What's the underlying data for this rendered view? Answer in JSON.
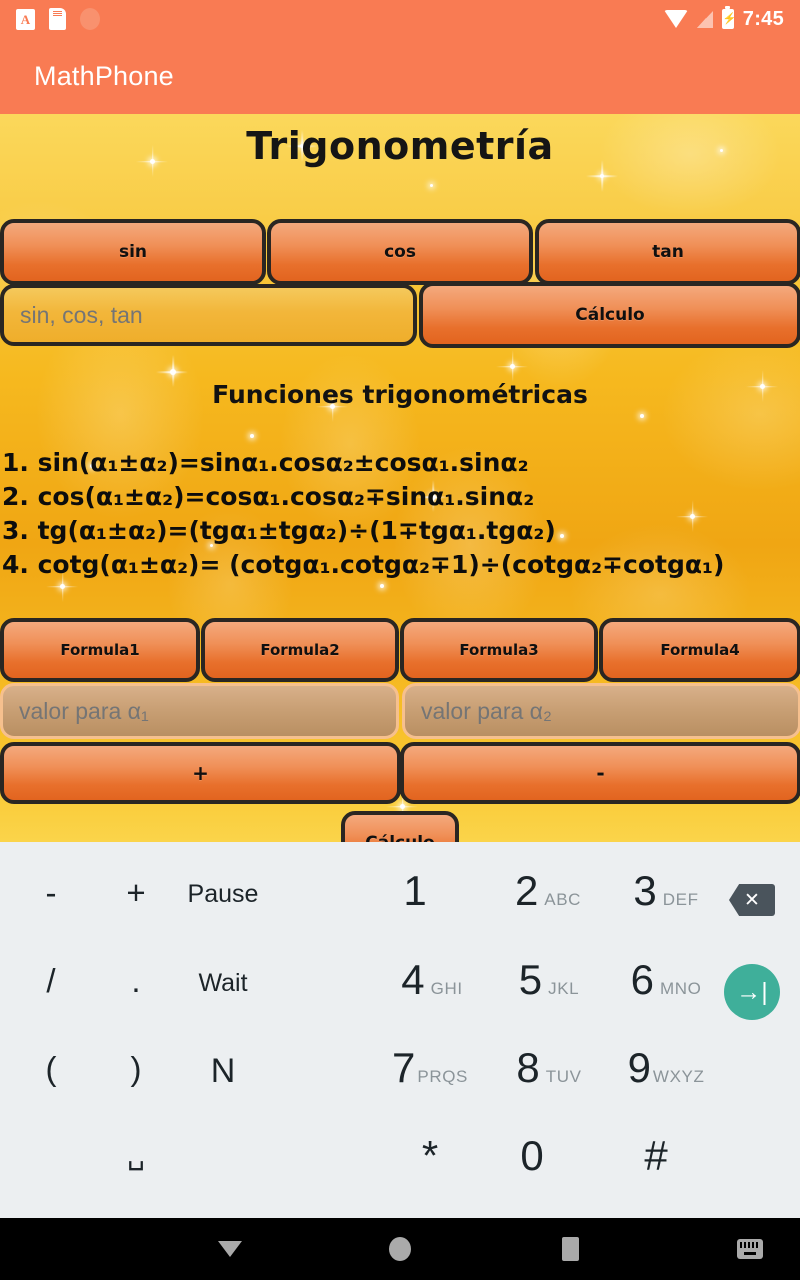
{
  "status_bar": {
    "time": "7:45",
    "icons_left": [
      "font-size-icon",
      "sim-card-icon",
      "circle-indicator-icon"
    ],
    "icons_right": [
      "wifi-icon",
      "cell-signal-icon",
      "battery-charging-icon"
    ],
    "background_color": "#F97B53"
  },
  "app_bar": {
    "title": "MathPhone",
    "background_color": "#F97B53",
    "text_color": "#FFFFFF"
  },
  "page": {
    "title": "Trigonometría",
    "section_title": "Funciones trigonométricas",
    "background_colors": [
      "#FBD85B",
      "#F0A613",
      "#FBD44A"
    ],
    "button_gradient": [
      "#F4A97D",
      "#E2641F"
    ],
    "button_border_color": "#2A2622"
  },
  "function_buttons": [
    {
      "label": "sin",
      "name": "sin-button"
    },
    {
      "label": "cos",
      "name": "cos-button"
    },
    {
      "label": "tan",
      "name": "tan-button"
    }
  ],
  "function_input": {
    "value": "",
    "placeholder": "sin, cos, tan"
  },
  "calc_button_top": {
    "label": "Cálculo"
  },
  "formulas": [
    {
      "num": "1.",
      "parts": [
        "sin(α",
        "1",
        "±α",
        "2",
        ")=sinα",
        "1",
        ".cosα",
        "2",
        "±cosα",
        "1",
        ".sinα",
        "2"
      ]
    },
    {
      "num": "2.",
      "parts": [
        "cos(α",
        "1",
        "±α",
        "2",
        ")=cosα",
        "1",
        ".cosα",
        "2",
        "∓sinα",
        "1",
        ".sinα",
        "2"
      ]
    },
    {
      "num": "3.",
      "parts": [
        "tg(α",
        "1",
        "±α",
        "2",
        ")=(tgα",
        "1",
        "±tgα",
        "2",
        ")÷(1∓tgα",
        "1",
        ".tgα",
        "2",
        ")"
      ]
    },
    {
      "num": "4.",
      "parts": [
        "cotg(α",
        "1",
        "±α",
        "2",
        ")= (cotgα",
        "1",
        ".cotgα",
        "2",
        "∓1)÷(cotgα",
        "2",
        "∓cotgα",
        "1",
        ")"
      ]
    }
  ],
  "formula_lines": {
    "l1": "1. sin(α₁±α₂)=sinα₁.cosα₂±cosα₁.sinα₂",
    "l2": "2. cos(α₁±α₂)=cosα₁.cosα₂∓sinα₁.sinα₂",
    "l3": "3. tg(α₁±α₂)=(tgα₁±tgα₂)÷(1∓tgα₁.tgα₂)",
    "l4": "4. cotg(α₁±α₂)= (cotgα₁.cotgα₂∓1)÷(cotgα₂∓cotgα₁)"
  },
  "formula_buttons": [
    {
      "label": "Formula1",
      "name": "formula1-button"
    },
    {
      "label": "Formula2",
      "name": "formula2-button"
    },
    {
      "label": "Formula3",
      "name": "formula3-button"
    },
    {
      "label": "Formula4",
      "name": "formula4-button"
    }
  ],
  "alpha_inputs": [
    {
      "value": "",
      "placeholder": "valor para α₁"
    },
    {
      "value": "",
      "placeholder": "valor para α₂"
    }
  ],
  "sign_buttons": [
    {
      "label": "+",
      "name": "plus-button"
    },
    {
      "label": "-",
      "name": "minus-button"
    }
  ],
  "calc_button_bottom": {
    "label": "Cálculo"
  },
  "keyboard": {
    "background_color": "#ECEFF1",
    "enter_color": "#3FAF9A",
    "backspace_color": "#4A545C",
    "left_pad": [
      [
        {
          "label": "-",
          "type": "sym"
        },
        {
          "label": "+",
          "type": "sym"
        },
        {
          "label": "Pause",
          "type": "word"
        }
      ],
      [
        {
          "label": "/",
          "type": "sym"
        },
        {
          "label": ".",
          "type": "sym"
        },
        {
          "label": "Wait",
          "type": "word"
        }
      ],
      [
        {
          "label": "(",
          "type": "sym"
        },
        {
          "label": ")",
          "type": "sym"
        },
        {
          "label": "N",
          "type": "word"
        }
      ],
      [
        {
          "label": "",
          "type": "sym"
        },
        {
          "label": "␣",
          "type": "sym"
        },
        {
          "label": "",
          "type": "word"
        }
      ]
    ],
    "number_pad": [
      [
        {
          "digit": "1",
          "letters": ""
        },
        {
          "digit": "2",
          "letters": "ABC"
        },
        {
          "digit": "3",
          "letters": "DEF"
        }
      ],
      [
        {
          "digit": "4",
          "letters": "GHI"
        },
        {
          "digit": "5",
          "letters": "JKL"
        },
        {
          "digit": "6",
          "letters": "MNO"
        }
      ],
      [
        {
          "digit": "7",
          "letters": "PRQS"
        },
        {
          "digit": "8",
          "letters": "TUV"
        },
        {
          "digit": "9",
          "letters": "WXYZ"
        }
      ],
      [
        {
          "digit": "*",
          "letters": ""
        },
        {
          "digit": "0",
          "letters": ""
        },
        {
          "digit": "#",
          "letters": ""
        }
      ]
    ],
    "backspace_glyph": "✕",
    "enter_glyph": "→|"
  },
  "nav_bar": {
    "items": [
      "back-icon",
      "home-icon",
      "recents-icon",
      "keyboard-switcher-icon"
    ],
    "background_color": "#000000"
  }
}
